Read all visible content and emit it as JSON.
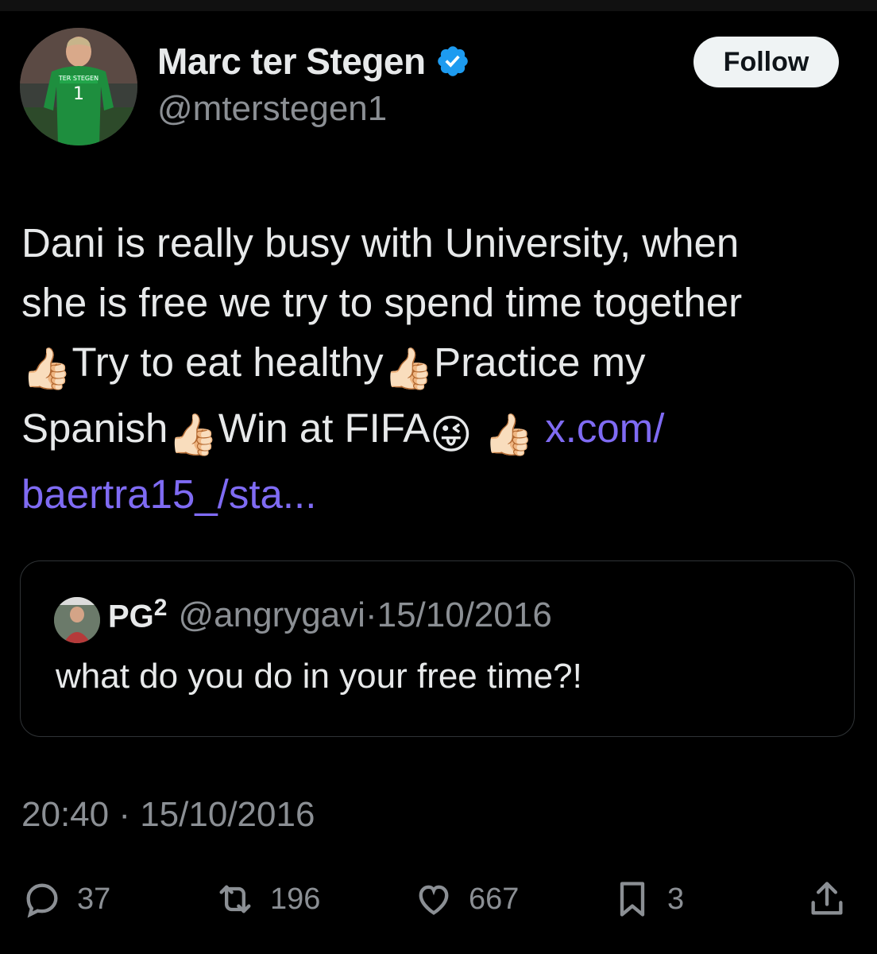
{
  "author": {
    "name": "Marc ter Stegen",
    "handle": "@mterstegen1",
    "verified_color": "#1d9bf0",
    "avatar_jersey_text": "TER STEGEN",
    "avatar_number": "1"
  },
  "follow_label": "Follow",
  "tweet": {
    "line1": "Dani is really busy with University, when",
    "line2": "she is free we try to spend time together",
    "seg3": "Try to eat healthy",
    "seg4": "Practice my",
    "seg5": "Spanish",
    "seg6": "Win at FIFA",
    "link1": "x.com/",
    "link2": "baertra15_/sta...",
    "emoji_thumbs": "👍🏻",
    "emoji_wink": "😜",
    "link_color": "#7f6bf3"
  },
  "quote": {
    "name": "PG",
    "name_sup": "2",
    "handle": "@angrygavi",
    "sep": "·",
    "date": "15/10/2016",
    "text": "what do you do in your free time?!"
  },
  "timestamp": "20:40 · 15/10/2016",
  "actions": {
    "reply_icon": "reply-icon",
    "replies": "37",
    "retweet_icon": "retweet-icon",
    "retweets": "196",
    "like_icon": "heart-icon",
    "likes": "667",
    "bookmark_icon": "bookmark-icon",
    "bookmarks": "3",
    "share_icon": "share-icon"
  }
}
